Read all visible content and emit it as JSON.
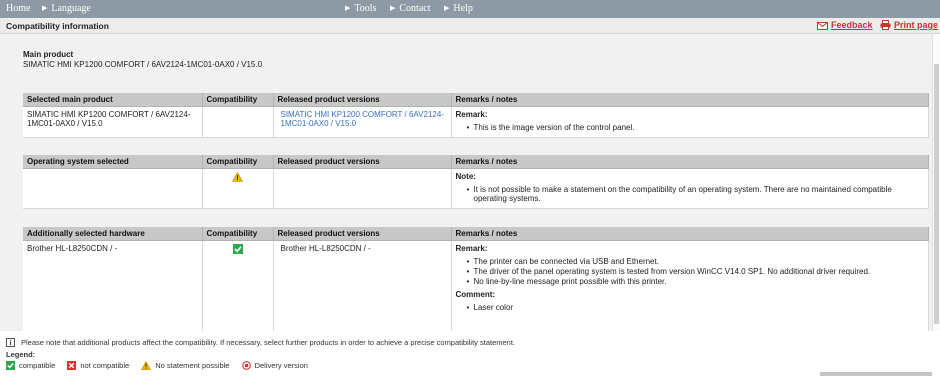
{
  "nav": {
    "home": "Home",
    "language": "Language",
    "tools": "Tools",
    "contact": "Contact",
    "help": "Help"
  },
  "header": {
    "title": "Compatibility information",
    "feedback": "Feedback",
    "print": "Print page"
  },
  "main_product": {
    "label": "Main product",
    "value": "SIMATIC HMI KP1200 COMFORT / 6AV2124-1MC01-0AX0 / V15.0"
  },
  "tables": [
    {
      "headers": [
        "Selected main product",
        "Compatibility",
        "Released product versions",
        "Remarks / notes"
      ],
      "product": "SIMATIC HMI KP1200 COMFORT / 6AV2124-1MC01-0AX0 / V15.0",
      "released": "SIMATIC HMI KP1200 COMFORT / 6AV2124-1MC01-0AX0 / V15.0",
      "remark_label": "Remark:",
      "remarks": [
        "This is the image version of the control panel."
      ]
    },
    {
      "headers": [
        "Operating system selected",
        "Compatibility",
        "Released product versions",
        "Remarks / notes"
      ],
      "product": "",
      "released": "",
      "remark_label": "Note:",
      "remarks": [
        "It is not possible to make a statement on the compatibility of an operating system. There are no maintained compatible operating systems."
      ]
    },
    {
      "headers": [
        "Additionally selected hardware",
        "Compatibility",
        "Released product versions",
        "Remarks / notes"
      ],
      "product": "Brother HL-L8250CDN / -",
      "released": "Brother HL-L8250CDN / -",
      "remark_label": "Remark:",
      "remarks": [
        "The printer can be connected via USB and Ethernet.",
        "The driver of the panel operating system is tested from version WinCC V14.0 SP1. No additional driver required.",
        "No line-by-line message print possible with this printer."
      ],
      "comment_label": "Comment:",
      "comments": [
        "Laser color"
      ]
    }
  ],
  "footer_note": "Please note that additional products affect the compatibility. If necessary, select further products in order to achieve a precise compatibility statement.",
  "legend": {
    "title": "Legend:",
    "compatible": "compatible",
    "not_compatible": "not compatible",
    "no_statement": "No statement possible",
    "delivery": "Delivery version"
  },
  "colors": {
    "nav_bg": "#8d9aa5",
    "header_bg": "#c8c8c8",
    "link": "#3a6fc4",
    "accent_red": "#c0392b",
    "check_green": "#2fa84f",
    "warn_yellow": "#f2b705"
  },
  "icons": {
    "feedback": "envelope-icon",
    "print": "printer-icon",
    "compat_table2": "warning-icon",
    "compat_table3": "check-icon"
  }
}
